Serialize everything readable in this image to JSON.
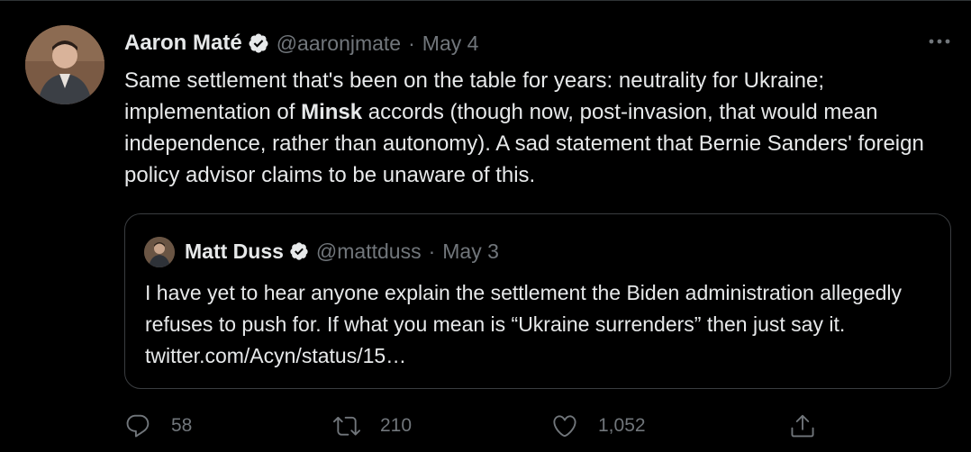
{
  "tweet": {
    "author": {
      "name": "Aaron Maté",
      "handle": "@aaronjmate",
      "date": "May 4",
      "separator": "·",
      "verified": true
    },
    "body": {
      "part1": "Same settlement that's been on the table for years: neutrality for Ukraine; implementation of ",
      "bold": "Minsk",
      "part2": " accords (though now, post-invasion, that would mean independence, rather than autonomy). A sad statement that Bernie Sanders' foreign policy advisor claims to be unaware of this."
    },
    "quote": {
      "author": {
        "name": "Matt Duss",
        "handle": "@mattduss",
        "date": "May 3",
        "separator": "·",
        "verified": true
      },
      "text": "I have yet to hear anyone explain the settlement the Biden administration allegedly refuses to push for. If what you mean is “Ukraine surrenders” then just say it. twitter.com/Acyn/status/15…"
    },
    "stats": {
      "replies": "58",
      "retweets": "210",
      "likes": "1,052"
    }
  },
  "colors": {
    "background": "#000000",
    "text": "#e7e9ea",
    "secondary": "#71767b",
    "border": "#2f3336"
  },
  "icons": [
    "verified-badge-icon",
    "more-icon",
    "reply-icon",
    "retweet-icon",
    "like-icon",
    "share-icon"
  ]
}
